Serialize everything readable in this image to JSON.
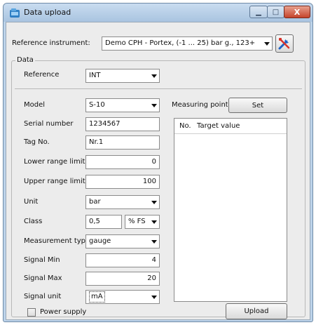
{
  "window": {
    "title": "Data upload",
    "controls": {
      "minimize": "▁",
      "maximize": "□",
      "close": "X"
    }
  },
  "reference_instrument": {
    "label": "Reference instrument:",
    "value": "Demo CPH - Portex, (-1 ... 25) bar g., 123+"
  },
  "data_group": {
    "label": "Data",
    "reference_label": "Reference",
    "reference_value": "INT"
  },
  "form": {
    "model_label": "Model",
    "model_value": "S-10",
    "serial_label": "Serial number",
    "serial_value": "1234567",
    "tag_label": "Tag No.",
    "tag_value": "Nr.1",
    "lower_label": "Lower range limit",
    "lower_value": "0",
    "upper_label": "Upper range limit",
    "upper_value": "100",
    "unit_label": "Unit",
    "unit_value": "bar",
    "class_label": "Class",
    "class_value": "0,5",
    "class_unit_value": "% FS",
    "mtype_label": "Measurement typ",
    "mtype_value": "gauge",
    "signal_min_label": "Signal Min",
    "signal_min_value": "4",
    "signal_max_label": "Signal Max",
    "signal_max_value": "20",
    "signal_unit_label": "Signal unit",
    "signal_unit_value": "mA",
    "power_supply_label": "Power supply"
  },
  "measuring": {
    "label": "Measuring point",
    "set_button": "Set",
    "col_no": "No.",
    "col_target": "Target value"
  },
  "upload_button": "Upload"
}
